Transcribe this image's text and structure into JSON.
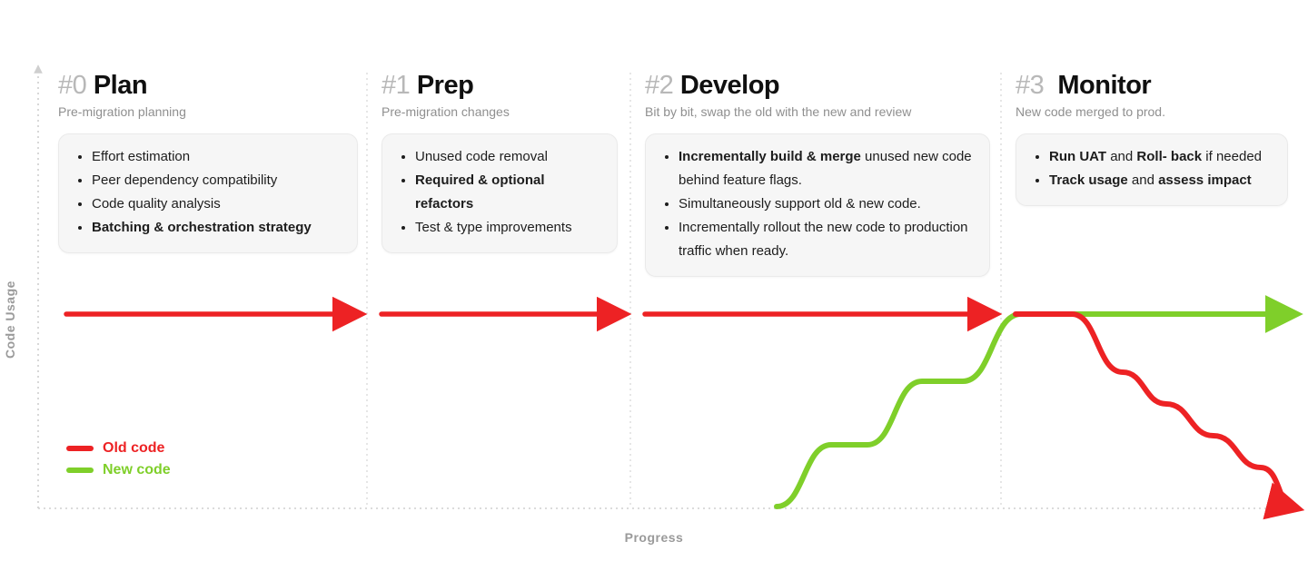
{
  "axes": {
    "y": "Code Usage",
    "x": "Progress"
  },
  "legend": {
    "old": "Old code",
    "new": "New code"
  },
  "phases": [
    {
      "num": "#0",
      "name": "Plan",
      "subtitle": "Pre-migration planning",
      "items": [
        {
          "text": "Effort estimation"
        },
        {
          "text": "Peer dependency compatibility"
        },
        {
          "text": "Code quality analysis"
        },
        {
          "bold_all": true,
          "text": "Batching & orchestration strategy"
        }
      ]
    },
    {
      "num": "#1",
      "name": "Prep",
      "subtitle": "Pre-migration changes",
      "items": [
        {
          "text": "Unused code removal"
        },
        {
          "bold_all": true,
          "text": "Required & optional refactors"
        },
        {
          "text": "Test & type improvements"
        }
      ]
    },
    {
      "num": "#2",
      "name": "Develop",
      "subtitle": "Bit by bit, swap the old with the new and review",
      "items": [
        {
          "segments": [
            {
              "t": "Incrementally build & merge",
              "b": true
            },
            {
              "t": " unused new code behind feature flags."
            }
          ]
        },
        {
          "text": "Simultaneously support old & new code."
        },
        {
          "text": "Incrementally rollout the new code to production traffic when ready."
        }
      ]
    },
    {
      "num": "#3",
      "name": "Monitor",
      "subtitle": "New code merged to prod.",
      "items": [
        {
          "segments": [
            {
              "t": "Run UAT",
              "b": true
            },
            {
              "t": " and "
            },
            {
              "t": "Roll- back",
              "b": true
            },
            {
              "t": " if needed"
            }
          ]
        },
        {
          "segments": [
            {
              "t": "Track usage",
              "b": true
            },
            {
              "t": " and "
            },
            {
              "t": "assess impact",
              "b": true
            }
          ]
        }
      ]
    }
  ],
  "colors": {
    "old": "#ed2224",
    "new": "#7fcf2a",
    "grid": "#d9d9d9",
    "muted": "#9a9a9a"
  },
  "chart_data": {
    "type": "line",
    "xlabel": "Progress",
    "ylabel": "Code Usage",
    "xlim": [
      0,
      4
    ],
    "ylim": [
      0,
      100
    ],
    "x_ticks_labels": [
      "#0 Plan",
      "#1 Prep",
      "#2 Develop",
      "#3 Monitor"
    ],
    "series": [
      {
        "name": "Old code",
        "color": "#ed2224",
        "x": [
          0.0,
          1.0,
          2.0,
          3.0,
          3.2,
          3.35,
          3.5,
          3.65,
          3.8,
          3.95,
          4.0
        ],
        "values": [
          100,
          100,
          100,
          100,
          100,
          70,
          55,
          40,
          25,
          5,
          0
        ]
      },
      {
        "name": "New code",
        "color": "#7fcf2a",
        "x": [
          2.0,
          2.4,
          2.55,
          2.7,
          2.85,
          3.0,
          4.0
        ],
        "values": [
          0,
          0,
          30,
          60,
          60,
          100,
          100
        ]
      }
    ]
  }
}
